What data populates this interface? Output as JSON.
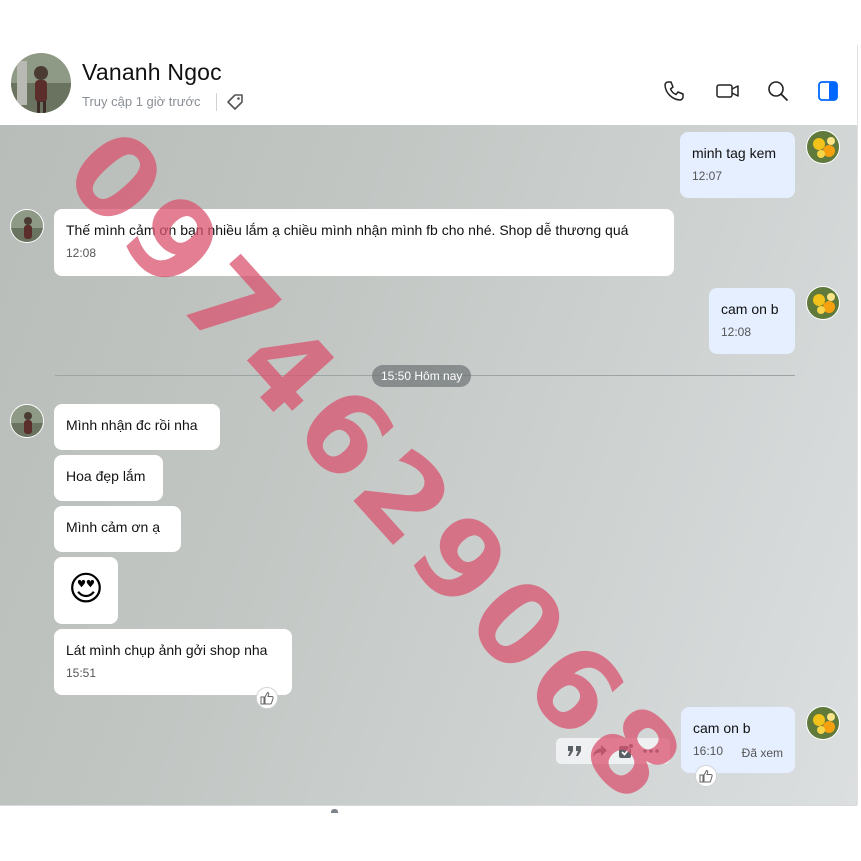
{
  "header": {
    "contact_name": "Vananh Ngoc",
    "last_seen": "Truy cập 1 giờ trước"
  },
  "icons": {
    "tag": "tag-icon",
    "call": "phone-icon",
    "video": "video-call-icon",
    "search": "search-icon",
    "info": "sidebar-toggle-icon"
  },
  "messages": [
    {
      "text": "minh tag kem",
      "time": "12:07",
      "from": "me"
    },
    {
      "text": "Thế mình cảm ơn bạn nhiều lắm ạ chiều mình nhận mình fb cho nhé. Shop dễ thương quá",
      "time": "12:08",
      "from": "them"
    },
    {
      "text": "cam on b",
      "time": "12:08",
      "from": "me"
    },
    {
      "text": "Mình nhận đc rồi nha",
      "from": "them"
    },
    {
      "text": "Hoa đẹp lắm",
      "from": "them"
    },
    {
      "text": "Mình cảm ơn ạ",
      "from": "them"
    },
    {
      "text": "😍",
      "from": "them"
    },
    {
      "text": "Lát mình chụp ảnh gởi shop nha",
      "time": "15:51",
      "from": "them"
    },
    {
      "text": "cam on b",
      "time": "16:10",
      "status": "Đã xem",
      "from": "me"
    }
  ],
  "divider": {
    "label": "15:50 Hôm nay"
  },
  "watermark": {
    "text": "0974629068",
    "color": "#d9536f"
  },
  "colors": {
    "my_bubble": "#e5efff",
    "their_bubble": "#ffffff",
    "accent": "#0068ff"
  }
}
